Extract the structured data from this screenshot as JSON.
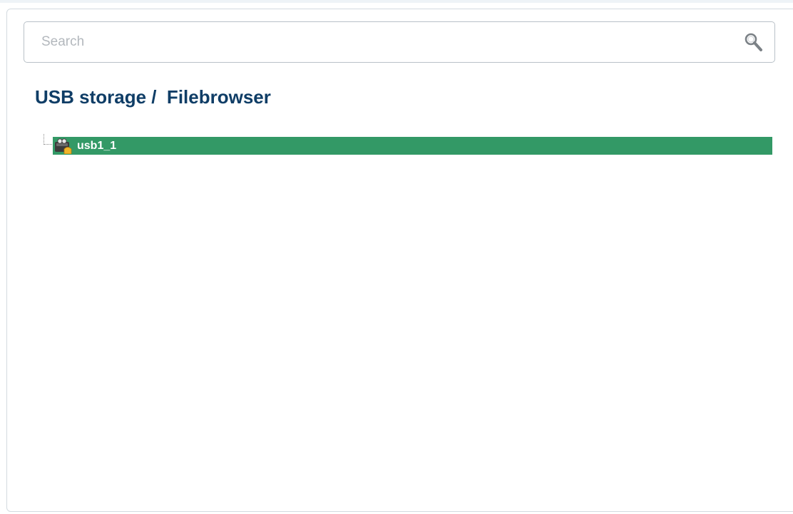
{
  "search": {
    "placeholder": "Search",
    "value": "",
    "icon": "search-icon"
  },
  "breadcrumb": {
    "section": "USB storage",
    "separator": "/",
    "page": "Filebrowser",
    "full": "USB storage /  Filebrowser"
  },
  "tree": {
    "items": [
      {
        "label": "usb1_1",
        "icon": "usb-drive-icon",
        "selected": true
      }
    ]
  },
  "colors": {
    "title": "#0f3d66",
    "selected_row": "#339966",
    "selected_text": "#ffffff",
    "placeholder": "#b3b8bd",
    "border": "#b9c1c8"
  }
}
